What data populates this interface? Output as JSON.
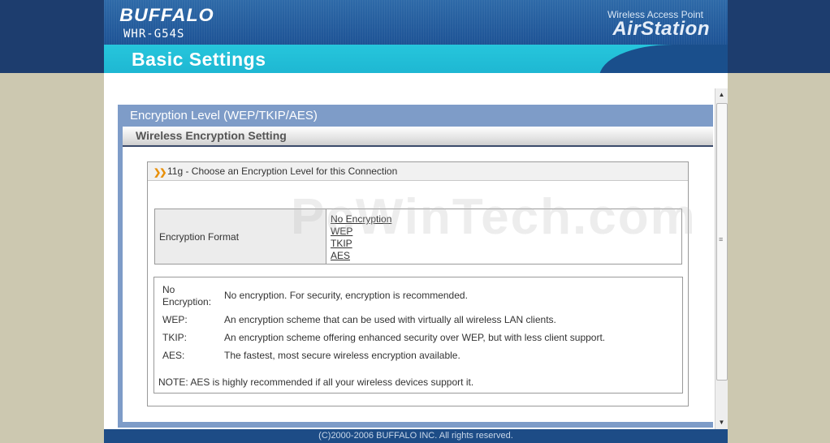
{
  "header": {
    "brand": "BUFFALO",
    "model": "WHR-G54S",
    "tagline": "Wireless Access Point",
    "product": "AirStation",
    "page_title": "Basic Settings"
  },
  "panel": {
    "title": "Encryption Level (WEP/TKIP/AES)",
    "section": "Wireless Encryption Setting"
  },
  "box": {
    "icon": "double-chevron-icon",
    "heading": "11g - Choose an Encryption Level for this Connection"
  },
  "format": {
    "label": "Encryption Format",
    "options": [
      "No Encryption",
      "WEP",
      "TKIP",
      "AES"
    ]
  },
  "descriptions": {
    "no_encryption": {
      "term_line1": "No",
      "term_line2": "Encryption:",
      "text": "No encryption. For security, encryption is recommended."
    },
    "wep": {
      "term": "WEP:",
      "text": "An encryption scheme that can be used with virtually all wireless LAN clients."
    },
    "tkip": {
      "term": "TKIP:",
      "text": "An encryption scheme offering enhanced security over WEP, but with less client support."
    },
    "aes": {
      "term": "AES:",
      "text": "The fastest, most secure wireless encryption available."
    },
    "note": "NOTE: AES is highly recommended if all your wireless devices support it."
  },
  "footer": "(C)2000-2006 BUFFALO INC. All rights reserved.",
  "watermark": "PcWinTech.com",
  "colors": {
    "background": "#ccc8b0",
    "header_blue": "#1f5597",
    "header_cyan": "#14a4c7",
    "panel_blue": "#7e9cc8",
    "footer_blue": "#1d4c86",
    "accent_orange": "#e8900a"
  }
}
